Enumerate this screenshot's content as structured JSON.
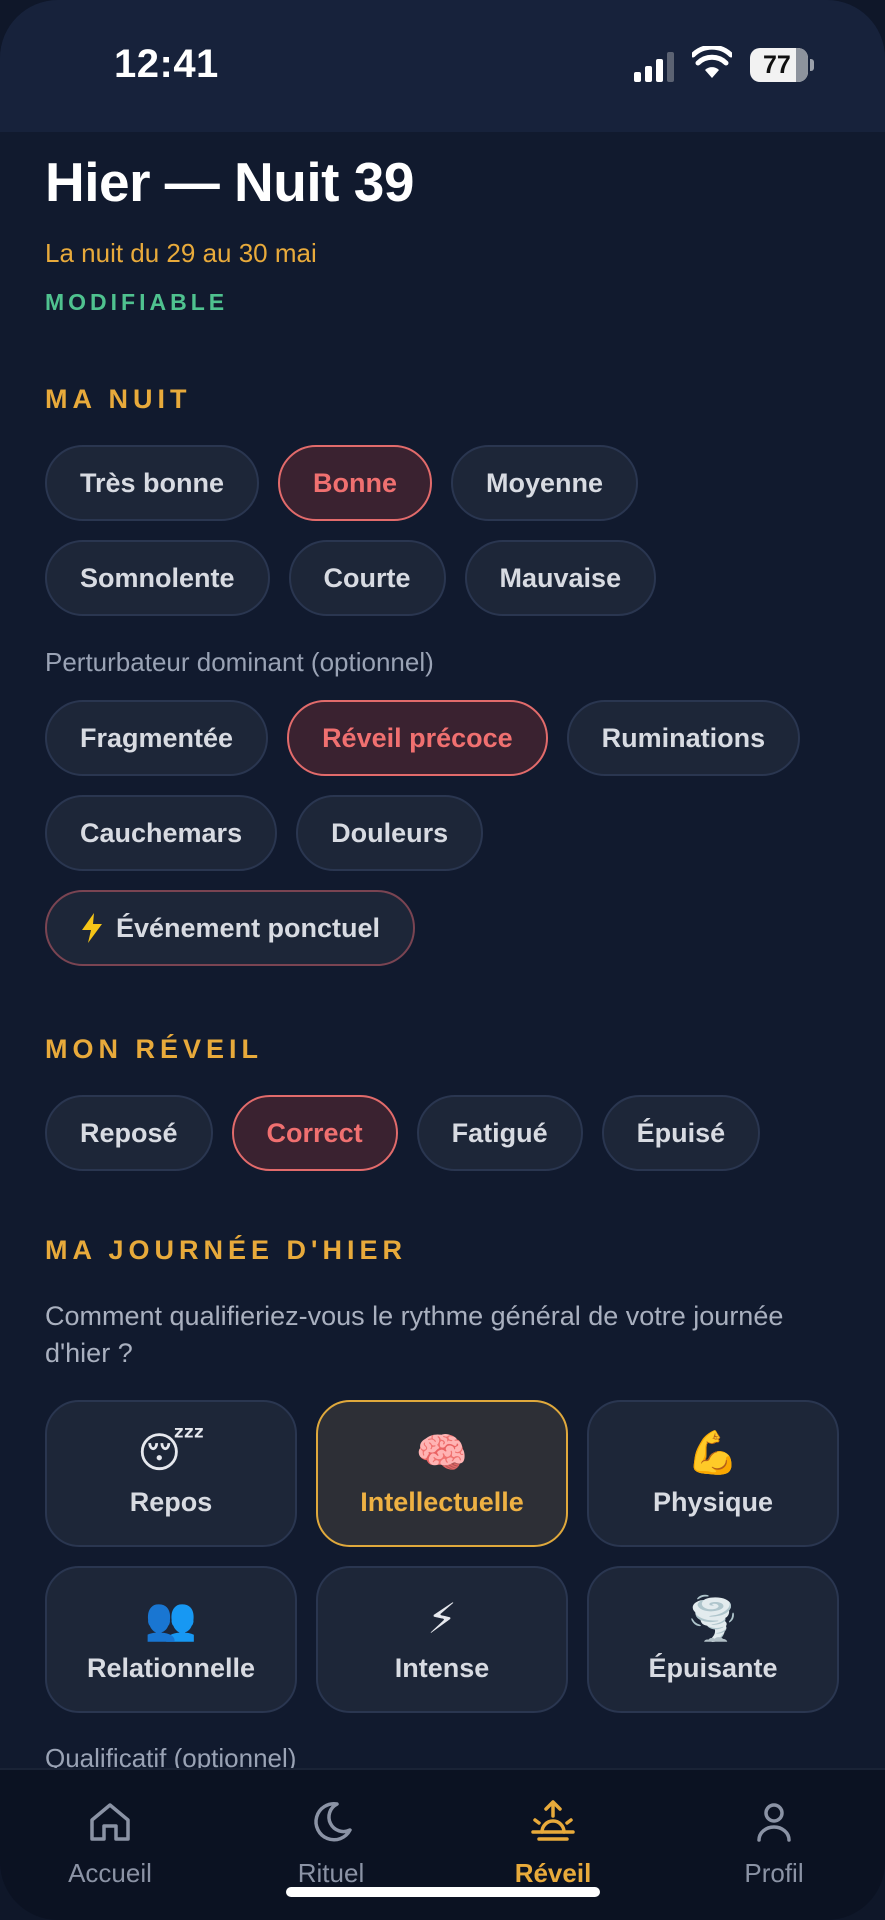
{
  "status": {
    "time": "12:41",
    "battery": "77"
  },
  "header": {
    "title": "Hier — Nuit 39",
    "subtitle": "La nuit du 29 au 30 mai",
    "badge": "MODIFIABLE"
  },
  "night": {
    "section": "MA NUIT",
    "options": [
      "Très bonne",
      "Bonne",
      "Moyenne",
      "Somnolente",
      "Courte",
      "Mauvaise"
    ],
    "selected": "Bonne",
    "disruptor_hint": "Perturbateur dominant (optionnel)",
    "disruptors": [
      "Fragmentée",
      "Réveil précoce",
      "Ruminations",
      "Cauchemars",
      "Douleurs"
    ],
    "disruptor_selected": "Réveil précoce",
    "event_label": "Événement ponctuel",
    "event_icon": "lightning-icon"
  },
  "wake": {
    "section": "MON RÉVEIL",
    "options": [
      "Reposé",
      "Correct",
      "Fatigué",
      "Épuisé"
    ],
    "selected": "Correct"
  },
  "day": {
    "section": "MA JOURNÉE D'HIER",
    "question": "Comment qualifieriez-vous le rythme général de votre journée d'hier ?",
    "cards": [
      {
        "emoji": "😴",
        "label": "Repos"
      },
      {
        "emoji": "🧠",
        "label": "Intellectuelle"
      },
      {
        "emoji": "💪",
        "label": "Physique"
      },
      {
        "emoji": "👥",
        "label": "Relationnelle"
      },
      {
        "emoji": "⚡",
        "label": "Intense"
      },
      {
        "emoji": "🌪️",
        "label": "Épuisante"
      }
    ],
    "selected": "Intellectuelle",
    "qualifier_hint": "Qualificatif (optionnel)"
  },
  "nav": {
    "items": [
      "Accueil",
      "Rituel",
      "Réveil",
      "Profil"
    ],
    "active": "Réveil"
  },
  "colors": {
    "accent": "#e8aa3b",
    "selected_red": "#f07070",
    "green": "#4fc28f",
    "background": "#111a2e"
  }
}
